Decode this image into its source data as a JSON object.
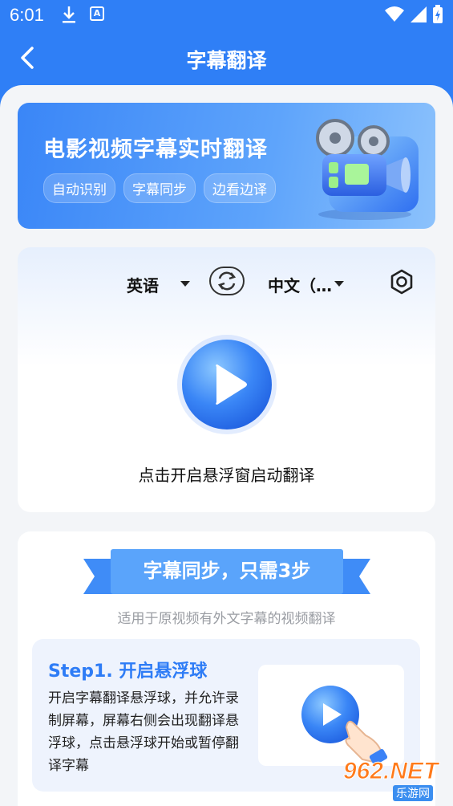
{
  "status_bar": {
    "time": "6:01"
  },
  "header": {
    "title": "字幕翻译"
  },
  "banner": {
    "title": "电影视频字幕实时翻译",
    "tags": [
      "自动识别",
      "字幕同步",
      "边看边译"
    ]
  },
  "translator": {
    "source_language": "英语",
    "target_language": "中文（…",
    "start_label": "点击开启悬浮窗启动翻译"
  },
  "steps": {
    "ribbon_title": "字幕同步，只需3步",
    "subtitle": "适用于原视频有外文字幕的视频翻译",
    "step1": {
      "title": "Step1. 开启悬浮球",
      "description": "开启字幕翻译悬浮球，并允许录制屏幕，屏幕右侧会出现翻译悬浮球，点击悬浮球开始或暂停翻译字幕"
    }
  },
  "watermark": {
    "text": "962.NET",
    "sub": "乐游网"
  },
  "colors": {
    "primary": "#2f7ff6",
    "background": "#f3f5f8",
    "accent_text": "#2e7cf6"
  }
}
